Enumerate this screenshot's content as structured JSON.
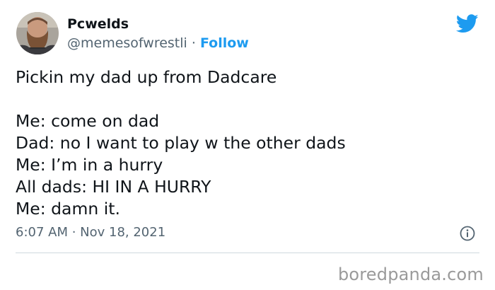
{
  "user": {
    "display_name": "Pcwelds",
    "handle": "@memesofwrestli",
    "separator": "·",
    "follow_label": "Follow",
    "avatar_icon": "user-avatar"
  },
  "brand": {
    "icon": "twitter-bird-icon",
    "color": "#1d9bf0"
  },
  "tweet": {
    "lines": [
      "Pickin my dad up from Dadcare",
      "",
      "Me: come on dad",
      "Dad: no I want to play w the other dads",
      "Me: I’m in a hurry",
      "All dads: HI IN A HURRY",
      "Me: damn it."
    ]
  },
  "meta": {
    "timestamp": "6:07 AM · Nov 18, 2021",
    "info_icon": "info-icon"
  },
  "watermark": {
    "text": "boredpanda.com"
  },
  "colors": {
    "text_primary": "#0f1419",
    "text_secondary": "#536471",
    "accent": "#1d9bf0",
    "divider": "#cfd9de",
    "watermark": "#9a9a9a"
  }
}
